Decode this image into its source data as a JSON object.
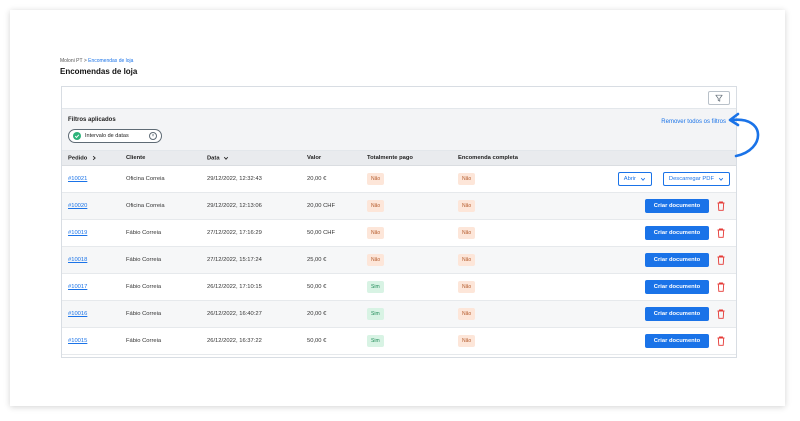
{
  "breadcrumb": {
    "root": "Moloni PT",
    "separator": ">",
    "current": "Encomendas de loja"
  },
  "page_title": "Encomendas de loja",
  "filters": {
    "label": "Filtros aplicados",
    "chip_label": "Intervalo de datas",
    "remove_all": "Remover todos os filtros"
  },
  "table": {
    "columns": {
      "order": "Pedido",
      "client": "Cliente",
      "date": "Data",
      "value": "Valor",
      "paid": "Totalmente pago",
      "complete": "Encomenda completa"
    },
    "rows": [
      {
        "order": "#10021",
        "client": "Oficina Correia",
        "date": "29/12/2022, 12:32:43",
        "value": "20,00 €",
        "paid": "Não",
        "complete": "Não"
      },
      {
        "order": "#10020",
        "client": "Oficina Correia",
        "date": "29/12/2022, 12:13:06",
        "value": "20,00 CHF",
        "paid": "Não",
        "complete": "Não"
      },
      {
        "order": "#10019",
        "client": "Fábio Correia",
        "date": "27/12/2022, 17:16:29",
        "value": "50,00 CHF",
        "paid": "Não",
        "complete": "Não"
      },
      {
        "order": "#10018",
        "client": "Fábio Correia",
        "date": "27/12/2022, 15:17:24",
        "value": "25,00 €",
        "paid": "Não",
        "complete": "Não"
      },
      {
        "order": "#10017",
        "client": "Fábio Correia",
        "date": "26/12/2022, 17:10:15",
        "value": "50,00 €",
        "paid": "Sim",
        "complete": "Não"
      },
      {
        "order": "#10016",
        "client": "Fábio Correia",
        "date": "26/12/2022, 16:40:27",
        "value": "20,00 €",
        "paid": "Sim",
        "complete": "Não"
      },
      {
        "order": "#10015",
        "client": "Fábio Correia",
        "date": "26/12/2022, 16:37:22",
        "value": "50,00 €",
        "paid": "Sim",
        "complete": "Não"
      }
    ]
  },
  "actions": {
    "open": "Abrir",
    "download_pdf": "Descarregar PDF",
    "create_document": "Criar documento"
  },
  "colors": {
    "primary": "#1a73e8",
    "no_badge_bg": "#fde6d9",
    "yes_badge_bg": "#d8f3e4",
    "trash": "#e53935"
  },
  "icons": [
    "funnel-icon",
    "check-icon",
    "close-icon",
    "chevron-right-icon",
    "chevron-down-icon",
    "trash-icon",
    "curved-arrow-icon"
  ]
}
